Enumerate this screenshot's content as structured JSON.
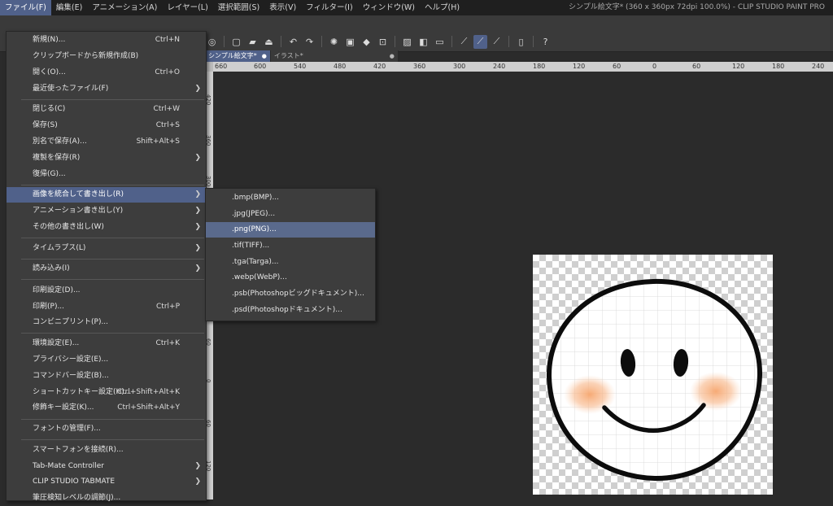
{
  "app": {
    "title": "シンプル絵文字* (360 x 360px 72dpi 100.0%)  - CLIP STUDIO PAINT PRO"
  },
  "menubar": [
    "ファイル(F)",
    "編集(E)",
    "アニメーション(A)",
    "レイヤー(L)",
    "選択範囲(S)",
    "表示(V)",
    "フィルター(I)",
    "ウィンドウ(W)",
    "ヘルプ(H)"
  ],
  "tabs": [
    {
      "label": "シンプル絵文字*",
      "close": "●"
    },
    {
      "label": "イラスト*",
      "close": "●"
    }
  ],
  "ruler": {
    "h": [
      "660",
      "600",
      "540",
      "480",
      "420",
      "360",
      "300",
      "240",
      "180",
      "120",
      "60",
      "0",
      "60",
      "120",
      "180",
      "240"
    ],
    "v": [
      "420",
      "360",
      "300",
      "240",
      "180",
      "120",
      "60",
      "0",
      "60",
      "120"
    ]
  },
  "file_menu": [
    {
      "label": "新規(N)...",
      "shortcut": "Ctrl+N"
    },
    {
      "label": "クリップボードから新規作成(B)",
      "shortcut": ""
    },
    {
      "label": "開く(O)...",
      "shortcut": "Ctrl+O"
    },
    {
      "label": "最近使ったファイル(F)",
      "shortcut": "",
      "arrow": "❯"
    },
    {
      "label": "閉じる(C)",
      "shortcut": "Ctrl+W"
    },
    {
      "label": "保存(S)",
      "shortcut": "Ctrl+S"
    },
    {
      "label": "別名で保存(A)...",
      "shortcut": "Shift+Alt+S"
    },
    {
      "label": "複製を保存(R)",
      "shortcut": "",
      "arrow": "❯"
    },
    {
      "label": "復帰(G)...",
      "shortcut": ""
    },
    {
      "label": "画像を統合して書き出し(R)",
      "shortcut": "",
      "arrow": "❯"
    },
    {
      "label": "アニメーション書き出し(Y)",
      "shortcut": "",
      "arrow": "❯"
    },
    {
      "label": "その他の書き出し(W)",
      "shortcut": "",
      "arrow": "❯"
    },
    {
      "label": "タイムラプス(L)",
      "shortcut": "",
      "arrow": "❯"
    },
    {
      "label": "読み込み(I)",
      "shortcut": "",
      "arrow": "❯"
    },
    {
      "label": "印刷設定(D)...",
      "shortcut": ""
    },
    {
      "label": "印刷(P)...",
      "shortcut": "Ctrl+P"
    },
    {
      "label": "コンビニプリント(P)...",
      "shortcut": ""
    },
    {
      "label": "環境設定(E)...",
      "shortcut": "Ctrl+K"
    },
    {
      "label": "プライバシー設定(E)...",
      "shortcut": ""
    },
    {
      "label": "コマンドバー設定(B)...",
      "shortcut": ""
    },
    {
      "label": "ショートカットキー設定(H)...",
      "shortcut": "Ctrl+Shift+Alt+K"
    },
    {
      "label": "修飾キー設定(K)...",
      "shortcut": "Ctrl+Shift+Alt+Y"
    },
    {
      "label": "フォントの管理(F)...",
      "shortcut": ""
    },
    {
      "label": "スマートフォンを接続(R)...",
      "shortcut": ""
    },
    {
      "label": "Tab-Mate Controller",
      "shortcut": "",
      "arrow": "❯"
    },
    {
      "label": "CLIP STUDIO TABMATE",
      "shortcut": "",
      "arrow": "❯"
    },
    {
      "label": "筆圧検知レベルの調節(J)...",
      "shortcut": ""
    }
  ],
  "export_submenu": [
    ".bmp(BMP)...",
    ".jpg(JPEG)...",
    ".png(PNG)...",
    ".tif(TIFF)...",
    ".tga(Targa)...",
    ".webp(WebP)...",
    ".psb(Photoshopビッグドキュメント)...",
    ".psd(Photoshopドキュメント)..."
  ],
  "colors": {
    "menu_highlight": "#50618a",
    "blush": "#f6b27f",
    "stroke": "#0c0c0c"
  }
}
